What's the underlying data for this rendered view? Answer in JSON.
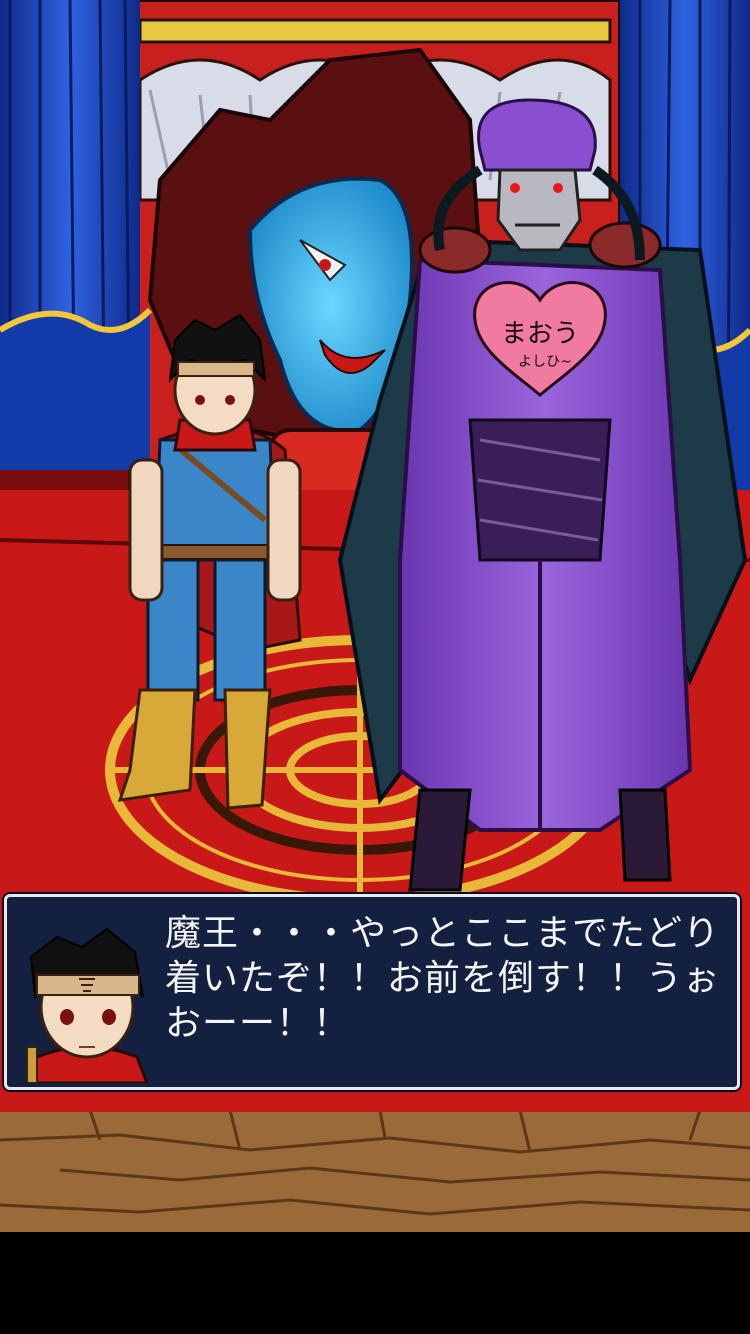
{
  "scene": {
    "villain_chest_text": "まおう",
    "villain_chest_subtext": "よしひ~"
  },
  "dialog": {
    "text": "魔王・・・やっとここまでたどり着いたぞ！！お前を倒す！！うぉおーー！！"
  },
  "colors": {
    "curtain_blue": "#1f46c8",
    "carpet_red": "#c81818",
    "dialog_bg": "#142040",
    "villain_robe": "#8a4fd0"
  }
}
